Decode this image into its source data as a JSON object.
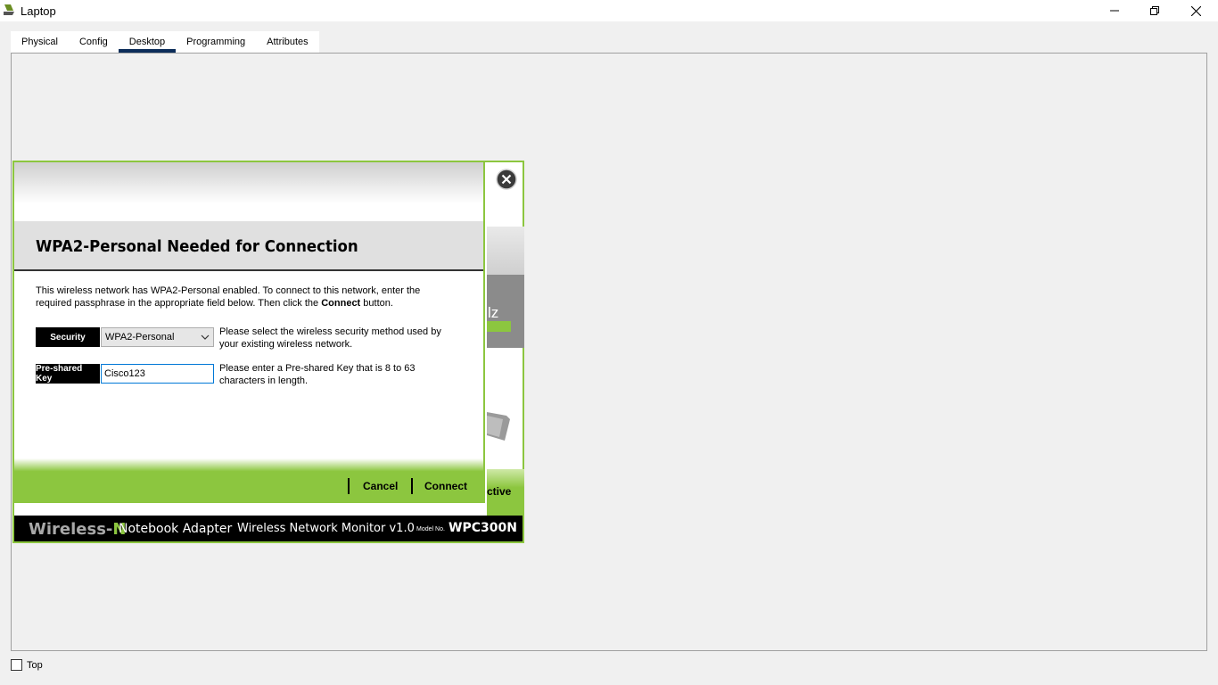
{
  "window": {
    "title": "Laptop"
  },
  "tabs": [
    {
      "label": "Physical"
    },
    {
      "label": "Config"
    },
    {
      "label": "Desktop",
      "active": true
    },
    {
      "label": "Programming"
    },
    {
      "label": "Attributes"
    }
  ],
  "monitor": {
    "bg_letters": "lz",
    "bg_active": "ctive",
    "brand_prefix": "Wireless-",
    "brand_suffix": "N",
    "adapter": "Notebook Adapter",
    "monitor_name": "Wireless Network Monitor  v1.0",
    "model_label": "Model No.",
    "model_no": "WPC300N"
  },
  "dialog": {
    "heading": "WPA2-Personal Needed for Connection",
    "intro_before": "This wireless network has WPA2-Personal enabled. To connect to this network, enter the required passphrase in the appropriate field below. Then click the ",
    "intro_bold": "Connect",
    "intro_after": " button.",
    "security_label": "Security",
    "security_value": "WPA2-Personal",
    "security_help": "Please select the wireless security method used by your existing wireless network.",
    "psk_label": "Pre-shared Key",
    "psk_value": "Cisco123",
    "psk_help": "Please enter a Pre-shared Key that is 8 to 63 characters in length.",
    "cancel_label": "Cancel",
    "connect_label": "Connect"
  },
  "bottom": {
    "top_label": "Top"
  },
  "colors": {
    "accent_green": "#8cc63f",
    "tab_underline": "#0c2d5a",
    "input_focus": "#0078d7"
  }
}
